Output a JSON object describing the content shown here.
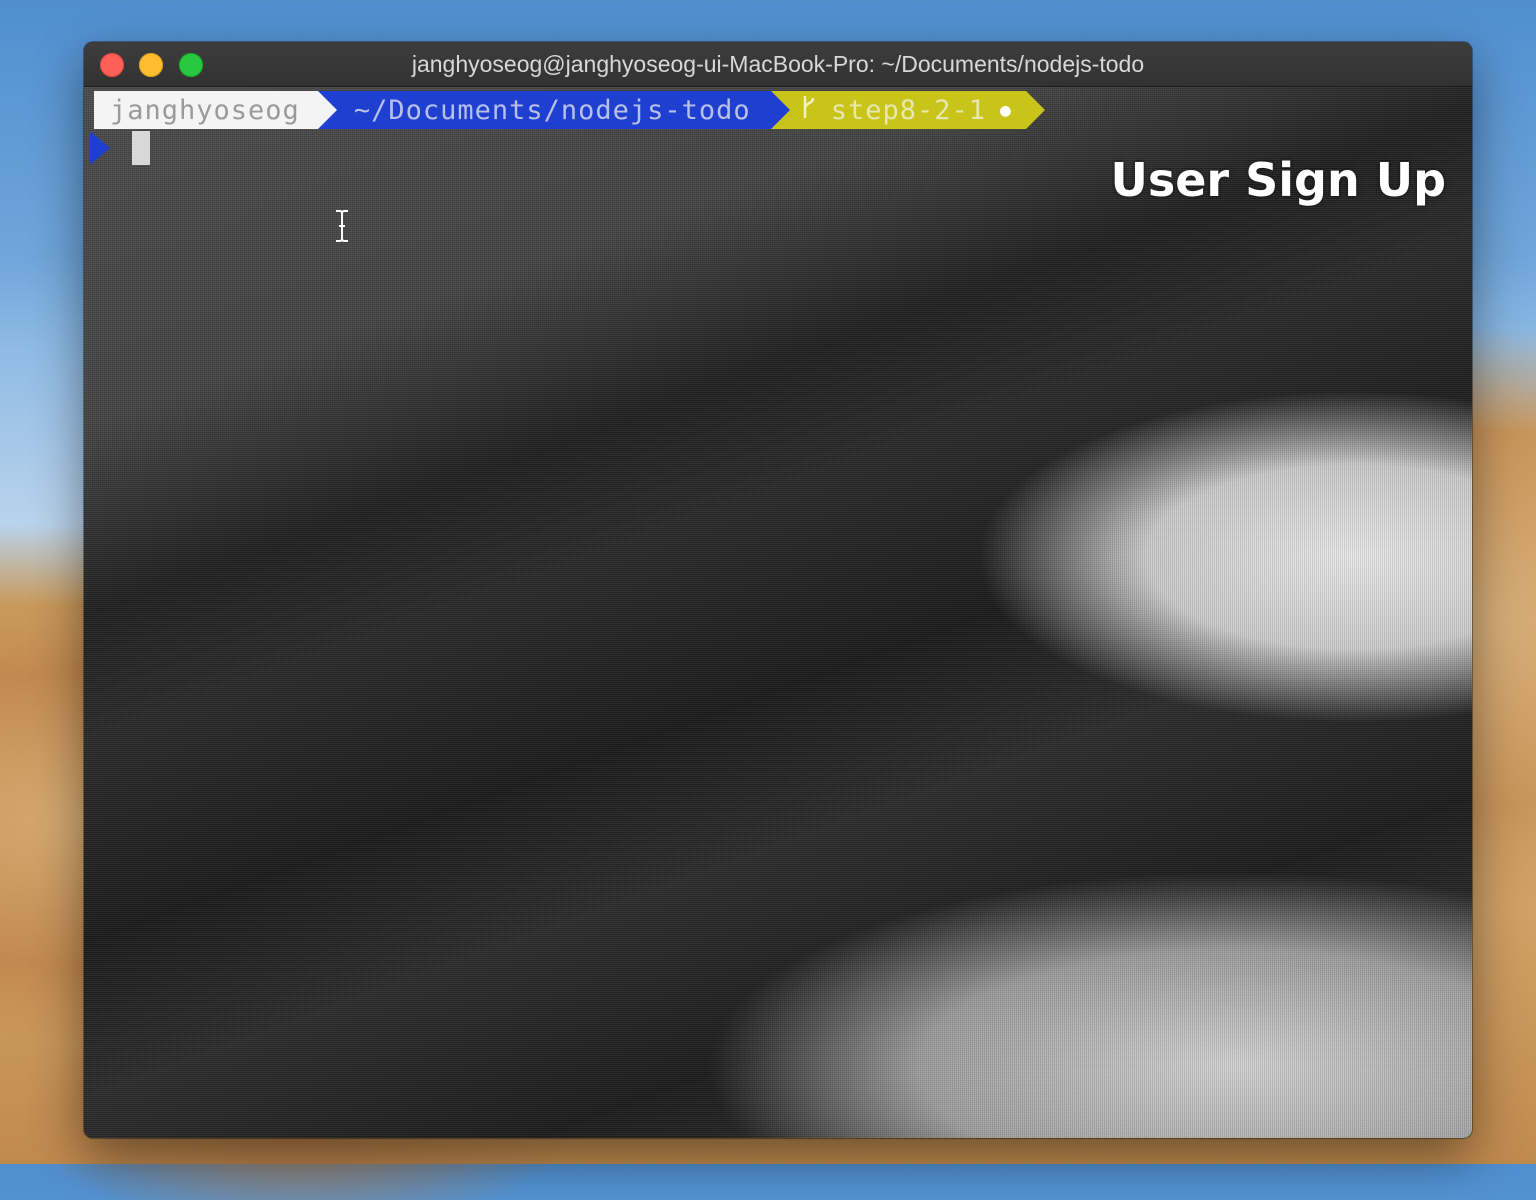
{
  "window": {
    "title": "janghyoseog@janghyoseog-ui-MacBook-Pro: ~/Documents/nodejs-todo"
  },
  "prompt": {
    "user": "janghyoseog",
    "path": "~/Documents/nodejs-todo",
    "branch_icon": "git-branch-icon",
    "branch": "step8-2-1",
    "dirty_indicator": "●"
  },
  "overlay": {
    "title": "User Sign Up"
  },
  "colors": {
    "user_segment": "#f4f4f4",
    "path_segment": "#1f3fd0",
    "branch_segment": "#c8c41a",
    "close": "#fe5f57",
    "minimize": "#febc2e",
    "maximize": "#28c840"
  }
}
